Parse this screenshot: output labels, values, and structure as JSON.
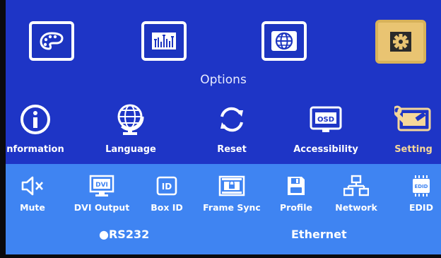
{
  "menu_title": "Options",
  "top_menu": [
    {
      "icon": "palette-icon",
      "selected": false
    },
    {
      "icon": "equalizer-icon",
      "selected": false
    },
    {
      "icon": "globe-icon",
      "selected": false
    },
    {
      "icon": "gear-icon",
      "selected": true
    }
  ],
  "options": [
    {
      "label": "nformation",
      "icon": "info-icon"
    },
    {
      "label": "Language",
      "icon": "globe-icon"
    },
    {
      "label": "Reset",
      "icon": "reset-icon"
    },
    {
      "label": "Accessibility",
      "icon": "osd-icon"
    },
    {
      "label": "Setting",
      "icon": "setting-icon",
      "selected": true
    }
  ],
  "settings": [
    {
      "label": "Mute",
      "icon": "mute-icon"
    },
    {
      "label": "DVI Output",
      "icon": "dvi-icon"
    },
    {
      "label": "Box ID",
      "icon": "id-icon"
    },
    {
      "label": "Frame Sync",
      "icon": "frame-sync-icon"
    },
    {
      "label": "Profile",
      "icon": "save-icon"
    },
    {
      "label": "Network",
      "icon": "network-icon"
    },
    {
      "label": "EDID",
      "icon": "edid-icon"
    }
  ],
  "footer": {
    "left_marker": "●",
    "left": "RS232",
    "right": "Ethernet"
  },
  "colors": {
    "panel": "#1e35c6",
    "settings_bar": "#3f84f2",
    "selected": "#e9c472",
    "text": "#ffffff"
  }
}
